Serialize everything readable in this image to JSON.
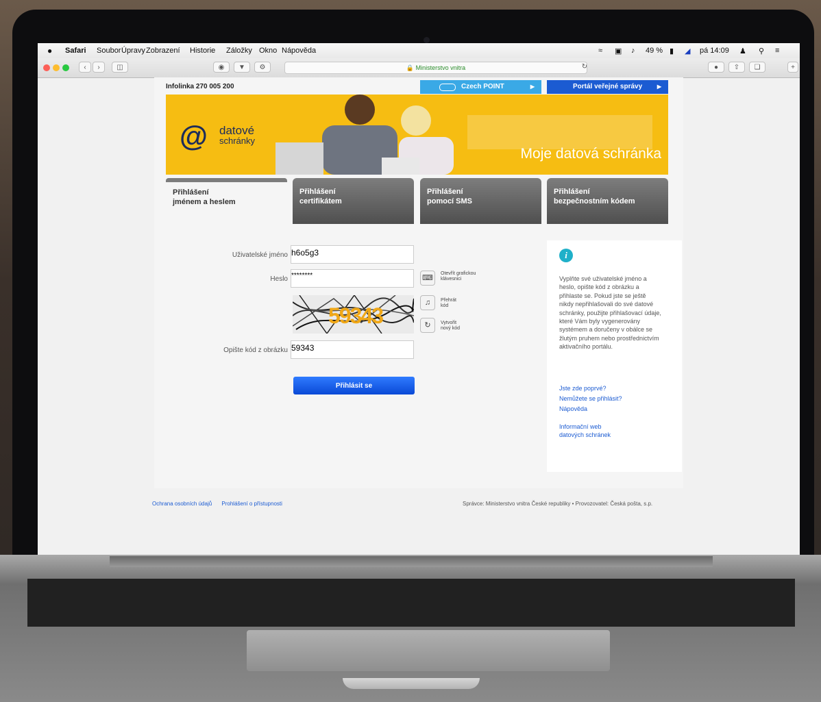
{
  "menubar": {
    "apple": "",
    "app": "Safari",
    "items": [
      "Soubor",
      "Úpravy",
      "Zobrazení",
      "Historie",
      "Záložky",
      "Okno",
      "Nápověda"
    ],
    "battery": "49 %",
    "clock": "pá 14:09"
  },
  "browser": {
    "address": "Ministerstvo vnitra"
  },
  "header": {
    "infoline": "Infolinka 270 005 200",
    "czech_point": "Czech POINT",
    "portal": "Portál veřejné správy"
  },
  "banner": {
    "logo_main": "datové",
    "logo_sub": "schránky",
    "tagline": "Moje datová schránka"
  },
  "tabs": [
    {
      "line1": "Přihlášení",
      "line2": "jménem a heslem"
    },
    {
      "line1": "Přihlášení",
      "line2": "certifikátem"
    },
    {
      "line1": "Přihlášení",
      "line2": "pomocí SMS"
    },
    {
      "line1": "Přihlášení",
      "line2": "bezpečnostním kódem"
    }
  ],
  "form": {
    "username_label": "Uživatelské jméno",
    "username_value": "h6o5g3",
    "password_label": "Heslo",
    "password_value": "********",
    "keyboard_line1": "Otevřít grafickou",
    "keyboard_line2": "klávesnici",
    "play_line1": "Přehrát",
    "play_line2": "kód",
    "new_line1": "Vytvořit",
    "new_line2": "nový kód",
    "captcha_text": "59343",
    "code_label": "Opište kód z obrázku",
    "code_value": "59343",
    "login_button": "Přihlásit se"
  },
  "info": {
    "text": "Vyplňte své uživatelské jméno a heslo, opište kód z obrázku a přihlaste se. Pokud jste se ještě nikdy nepřihlašovali do své datové schránky, použijte přihlašovací údaje, které Vám byly vygenerovány systémem a doručeny v obálce se žlutým pruhem nebo prostřednictvím aktivačního portálu.",
    "link_first": "Jste zde poprvé?",
    "link_cant": "Nemůžete se přihlásit?",
    "link_help": "Nápověda",
    "link_web1": "Informační web",
    "link_web2": "datových schránek"
  },
  "footer": {
    "privacy": "Ochrana osobních údajů",
    "accessibility": "Prohlášení o přístupnosti",
    "operator": "Správce: Ministerstvo vnitra České republiky • Provozovatel: Česká pošta, s.p."
  },
  "colors": {
    "banner_yellow": "#f6bd12",
    "czech_point_blue": "#3aa9e6",
    "portal_blue": "#1b5bd2",
    "login_blue": "#0a49d6",
    "info_teal": "#1fb0c9"
  }
}
